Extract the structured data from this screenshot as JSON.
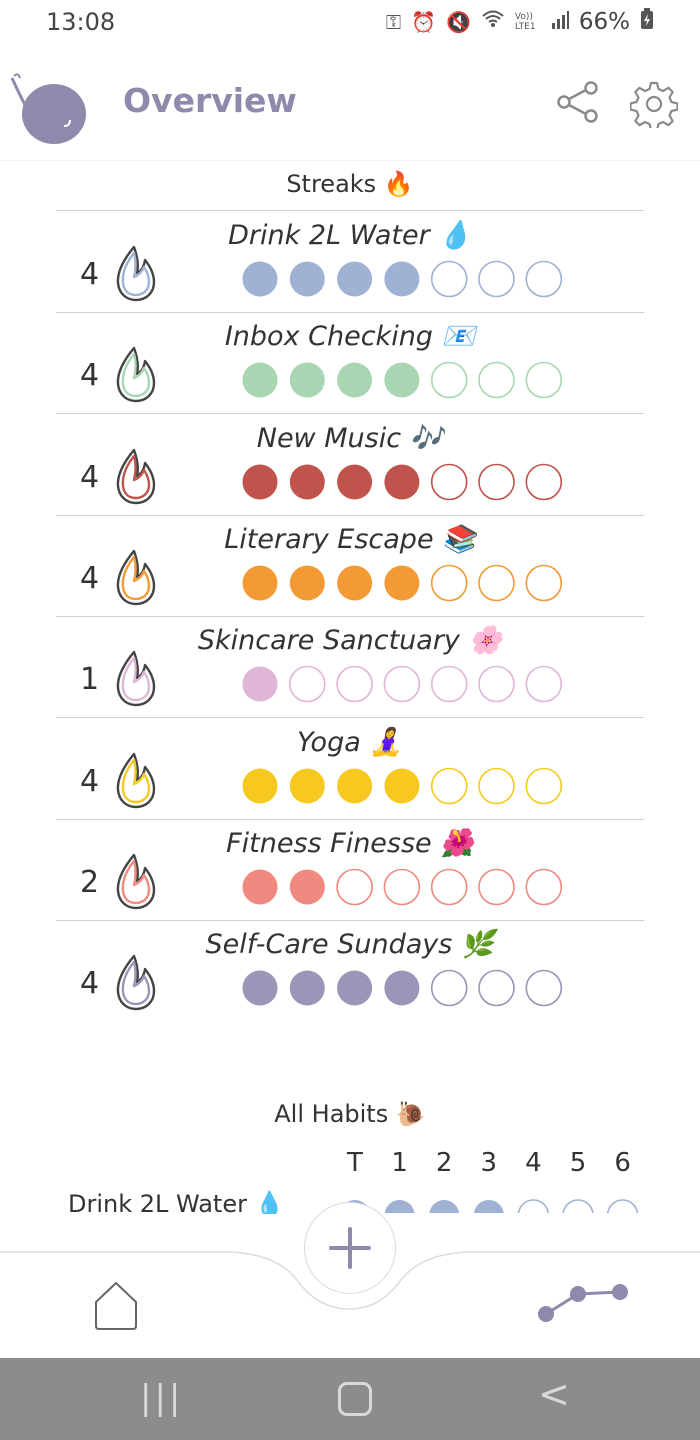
{
  "status_bar": {
    "time": "13:08",
    "icons": [
      "key-icon",
      "alarm-icon",
      "mute-icon",
      "wifi-icon",
      "volte-icon",
      "signal-icon"
    ],
    "volte": "Vo)) LTE1",
    "battery": "66%"
  },
  "header": {
    "title": "Overview"
  },
  "streaks": {
    "title": "Streaks 🔥",
    "habits": [
      {
        "name": "Drink 2L Water 💧",
        "streak": "4",
        "filled": 4,
        "total": 7,
        "color": "#a0b2d3"
      },
      {
        "name": "Inbox Checking 📧",
        "streak": "4",
        "filled": 4,
        "total": 7,
        "color": "#a9d6b2"
      },
      {
        "name": "New Music 🎶",
        "streak": "4",
        "filled": 4,
        "total": 7,
        "color": "#c0534b"
      },
      {
        "name": "Literary Escape 📚",
        "streak": "4",
        "filled": 4,
        "total": 7,
        "color": "#f39a34"
      },
      {
        "name": "Skincare Sanctuary 🌸",
        "streak": "1",
        "filled": 1,
        "total": 7,
        "color": "#dfb6d6"
      },
      {
        "name": "Yoga 🧘‍♀️",
        "streak": "4",
        "filled": 4,
        "total": 7,
        "color": "#f7c920"
      },
      {
        "name": "Fitness Finesse 🌺",
        "streak": "2",
        "filled": 2,
        "total": 7,
        "color": "#f08a80"
      },
      {
        "name": "Self-Care Sundays 🌿",
        "streak": "4",
        "filled": 4,
        "total": 7,
        "color": "#9b95b8"
      }
    ]
  },
  "all_habits": {
    "title": "All Habits 🐌",
    "days": [
      "T",
      "1",
      "2",
      "3",
      "4",
      "5",
      "6"
    ],
    "rows": [
      {
        "name": "Drink 2L Water 💧",
        "filled": 4,
        "total": 7,
        "color": "#a0b2d3"
      }
    ]
  },
  "colors": {
    "accent": "#8f8aac",
    "nav_bar": "#8c8c8c"
  }
}
